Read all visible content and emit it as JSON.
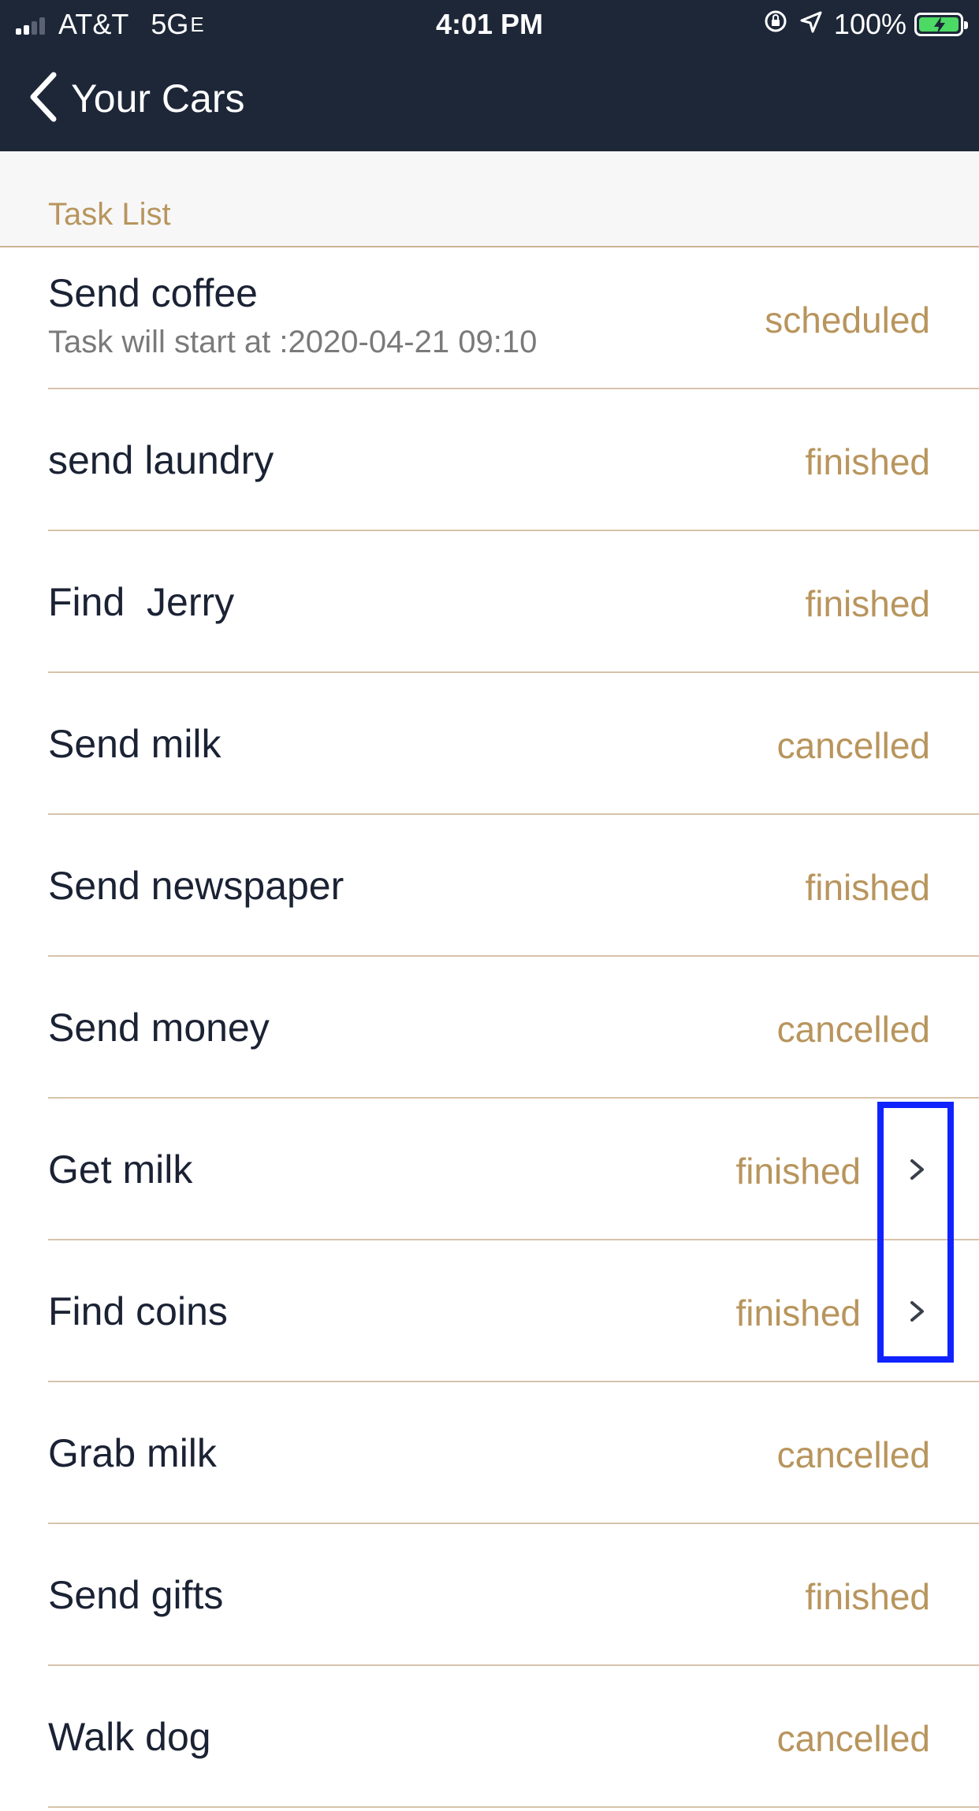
{
  "status_bar": {
    "carrier": "AT&T",
    "network": "5G",
    "network_suffix": "E",
    "time": "4:01 PM",
    "battery": "100%",
    "battery_level": 1.0
  },
  "nav": {
    "back_label": "Your Cars"
  },
  "section": {
    "title": "Task List"
  },
  "tasks": [
    {
      "title": "Send coffee",
      "subtitle": "Task will start at :2020-04-21 09:10",
      "status": "scheduled",
      "chevron": false
    },
    {
      "title": "send laundry",
      "status": "finished",
      "chevron": false
    },
    {
      "title": "Find  Jerry",
      "status": "finished",
      "chevron": false
    },
    {
      "title": "Send milk",
      "status": "cancelled",
      "chevron": false
    },
    {
      "title": "Send newspaper",
      "status": "finished",
      "chevron": false
    },
    {
      "title": "Send money",
      "status": "cancelled",
      "chevron": false
    },
    {
      "title": "Get milk",
      "status": "finished",
      "chevron": true
    },
    {
      "title": "Find coins",
      "status": "finished",
      "chevron": true
    },
    {
      "title": "Grab milk",
      "status": "cancelled",
      "chevron": false
    },
    {
      "title": "Send gifts",
      "status": "finished",
      "chevron": false
    },
    {
      "title": "Walk dog",
      "status": "cancelled",
      "chevron": false
    }
  ],
  "icons": {
    "signal": "signal-icon",
    "orientation_lock": "orientation-lock-icon",
    "location": "location-arrow-icon",
    "battery": "battery-charging-icon",
    "back": "chevron-left-icon",
    "disclosure": "chevron-right-icon"
  },
  "colors": {
    "header_bg": "#1d2738",
    "accent": "#b8955d",
    "text_primary": "#1b2234",
    "text_secondary": "#7a7a7a",
    "divider": "#d7c3aa",
    "battery_green": "#4cd964",
    "highlight": "#1023ff"
  }
}
